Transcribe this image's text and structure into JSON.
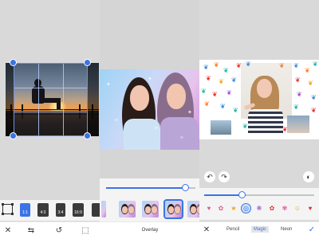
{
  "crop_panel": {
    "ratios": [
      {
        "label": "1:1",
        "active": true
      },
      {
        "label": "4:3",
        "active": false
      },
      {
        "label": "3:4",
        "active": false
      },
      {
        "label": "16:9",
        "active": false
      }
    ],
    "bottom_icons": [
      "close-icon",
      "flip-icon",
      "rotate-icon",
      "perspective-icon"
    ]
  },
  "overlay_panel": {
    "title": "Overlay",
    "slider_value_pct": 88,
    "thumbnails": 5,
    "selected_thumbnail": 4
  },
  "magic_panel": {
    "slider_value_pct": 34,
    "modes": {
      "pencil": "Pencil",
      "magic": "Magic",
      "neon": "Neon"
    },
    "active_mode": "Magic",
    "emoji_brushes": [
      "♥",
      "✿",
      "★",
      "◎",
      "❋",
      "✿",
      "☺"
    ],
    "selected_brush": 3,
    "colors": {
      "accent": "#3a73e6",
      "background": "#d8d8d8",
      "toolbar": "#ffffff"
    }
  }
}
